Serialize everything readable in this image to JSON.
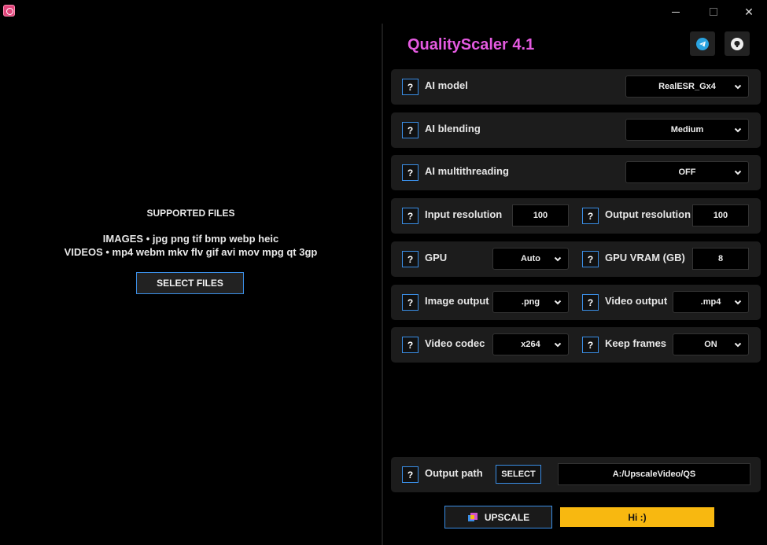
{
  "window": {
    "minimize_label": "",
    "maximize_label": "",
    "close_label": "✕"
  },
  "left": {
    "supported_title": "SUPPORTED FILES",
    "images_line": "IMAGES • jpg png tif bmp webp heic",
    "videos_line": "VIDEOS • mp4 webm mkv flv gif avi mov mpg qt 3gp",
    "select_files_label": "SELECT FILES"
  },
  "header": {
    "title": "QualityScaler 4.1",
    "title_color": "#e45ae0",
    "telegram_icon": "telegram-icon",
    "github_icon": "github-icon"
  },
  "settings": {
    "help_label": "?",
    "ai_model": {
      "label": "AI model",
      "value": "RealESR_Gx4"
    },
    "ai_blending": {
      "label": "AI blending",
      "value": "Medium"
    },
    "ai_multithreading": {
      "label": "AI multithreading",
      "value": "OFF"
    },
    "input_resolution": {
      "label": "Input resolution",
      "value": "100"
    },
    "output_resolution": {
      "label": "Output resolution",
      "value": "100"
    },
    "gpu": {
      "label": "GPU",
      "value": "Auto"
    },
    "gpu_vram": {
      "label": "GPU VRAM (GB)",
      "value": "8"
    },
    "image_output": {
      "label": "Image output",
      "value": ".png"
    },
    "video_output": {
      "label": "Video output",
      "value": ".mp4"
    },
    "video_codec": {
      "label": "Video codec",
      "value": "x264"
    },
    "keep_frames": {
      "label": "Keep frames",
      "value": "ON"
    }
  },
  "output": {
    "label": "Output path",
    "select_label": "SELECT",
    "path": "A:/UpscaleVideo/QS"
  },
  "actions": {
    "upscale_label": "UPSCALE",
    "status_text": "Hi :)",
    "status_color": "#f8b810",
    "accent_color": "#3a8ee6"
  }
}
